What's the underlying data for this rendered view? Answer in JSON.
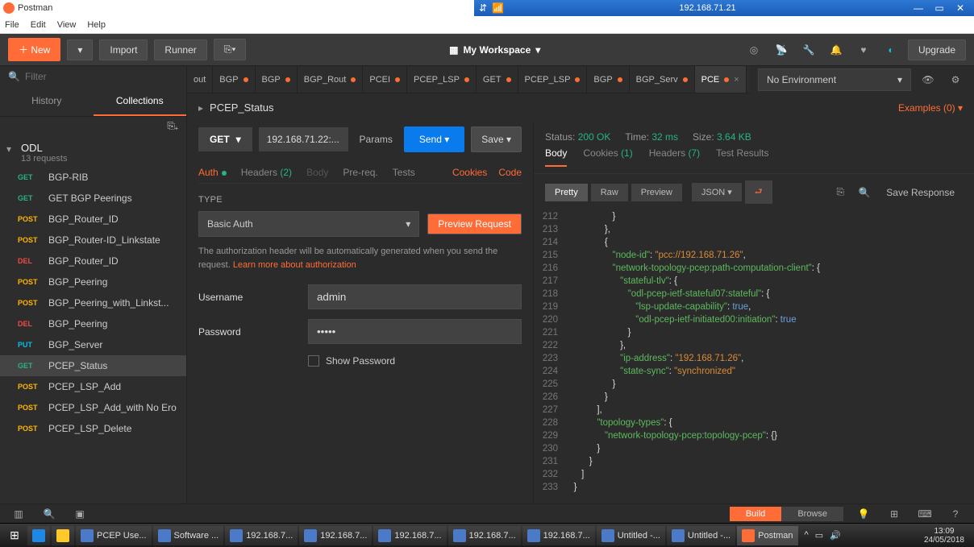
{
  "titlebar": {
    "app": "Postman",
    "ip": "192.168.71.21"
  },
  "menubar": [
    "File",
    "Edit",
    "View",
    "Help"
  ],
  "toolbar": {
    "new": "New",
    "import": "Import",
    "runner": "Runner",
    "workspace": "My Workspace",
    "upgrade": "Upgrade"
  },
  "sidebar": {
    "filter_placeholder": "Filter",
    "tabs": {
      "history": "History",
      "collections": "Collections"
    },
    "collection": {
      "name": "ODL",
      "sub": "13 requests"
    },
    "requests": [
      {
        "method": "GET",
        "name": "BGP-RIB"
      },
      {
        "method": "GET",
        "name": "GET BGP Peerings"
      },
      {
        "method": "POST",
        "name": "BGP_Router_ID"
      },
      {
        "method": "POST",
        "name": "BGP_Router-ID_Linkstate"
      },
      {
        "method": "DEL",
        "name": "BGP_Router_ID"
      },
      {
        "method": "POST",
        "name": "BGP_Peering"
      },
      {
        "method": "POST",
        "name": "BGP_Peering_with_Linkst..."
      },
      {
        "method": "DEL",
        "name": "BGP_Peering"
      },
      {
        "method": "PUT",
        "name": "BGP_Server"
      },
      {
        "method": "GET",
        "name": "PCEP_Status",
        "active": true
      },
      {
        "method": "POST",
        "name": "PCEP_LSP_Add"
      },
      {
        "method": "POST",
        "name": "PCEP_LSP_Add_with No Ero"
      },
      {
        "method": "POST",
        "name": "PCEP_LSP_Delete"
      }
    ]
  },
  "tabs": [
    {
      "label": "out",
      "dirty": false
    },
    {
      "label": "BGP",
      "dirty": true
    },
    {
      "label": "BGP",
      "dirty": true
    },
    {
      "label": "BGP_Rout",
      "dirty": true
    },
    {
      "label": "PCEI",
      "dirty": true
    },
    {
      "label": "PCEP_LSP",
      "dirty": true
    },
    {
      "label": "GET",
      "dirty": true
    },
    {
      "label": "PCEP_LSP",
      "dirty": true
    },
    {
      "label": "BGP",
      "dirty": true
    },
    {
      "label": "BGP_Serv",
      "dirty": true
    },
    {
      "label": "PCE",
      "active": true,
      "dirty": true
    }
  ],
  "env": {
    "selected": "No Environment"
  },
  "request": {
    "name": "PCEP_Status",
    "examples": "Examples (0)",
    "method": "GET",
    "url": "192.168.71.22:...",
    "params": "Params",
    "send": "Send",
    "save": "Save",
    "tabs": {
      "auth": "Auth",
      "headers": "Headers",
      "headers_cnt": "(2)",
      "body": "Body",
      "prereq": "Pre-req.",
      "tests": "Tests",
      "cookies": "Cookies",
      "code": "Code"
    },
    "type_label": "TYPE",
    "auth_type": "Basic Auth",
    "preview": "Preview Request",
    "help": "The authorization header will be automatically generated when you send the request. ",
    "help_link": "Learn more about authorization",
    "username_label": "Username",
    "username": "admin",
    "password_label": "Password",
    "password": "•••••",
    "show_pw": "Show Password"
  },
  "response": {
    "status_lbl": "Status:",
    "status": "200 OK",
    "time_lbl": "Time:",
    "time": "32 ms",
    "size_lbl": "Size:",
    "size": "3.64 KB",
    "tabs": {
      "body": "Body",
      "cookies": "Cookies",
      "cookies_cnt": "(1)",
      "headers": "Headers",
      "headers_cnt": "(7)",
      "tests": "Test Results"
    },
    "view": {
      "pretty": "Pretty",
      "raw": "Raw",
      "preview": "Preview",
      "fmt": "JSON"
    },
    "save": "Save Response",
    "lines": [
      {
        "n": 212,
        "t": "                  }"
      },
      {
        "n": 213,
        "t": "               },"
      },
      {
        "n": 214,
        "t": "               {"
      },
      {
        "n": 215,
        "t": "                  \"node-id\": \"pcc://192.168.71.26\","
      },
      {
        "n": 216,
        "t": "                  \"network-topology-pcep:path-computation-client\": {"
      },
      {
        "n": 217,
        "t": "                     \"stateful-tlv\": {"
      },
      {
        "n": 218,
        "t": "                        \"odl-pcep-ietf-stateful07:stateful\": {"
      },
      {
        "n": 219,
        "t": "                           \"lsp-update-capability\": true,"
      },
      {
        "n": 220,
        "t": "                           \"odl-pcep-ietf-initiated00:initiation\": true"
      },
      {
        "n": 221,
        "t": "                        }"
      },
      {
        "n": 222,
        "t": "                     },"
      },
      {
        "n": 223,
        "t": "                     \"ip-address\": \"192.168.71.26\","
      },
      {
        "n": 224,
        "t": "                     \"state-sync\": \"synchronized\""
      },
      {
        "n": 225,
        "t": "                  }"
      },
      {
        "n": 226,
        "t": "               }"
      },
      {
        "n": 227,
        "t": "            ],"
      },
      {
        "n": 228,
        "t": "            \"topology-types\": {"
      },
      {
        "n": 229,
        "t": "               \"network-topology-pcep:topology-pcep\": {}"
      },
      {
        "n": 230,
        "t": "            }"
      },
      {
        "n": 231,
        "t": "         }"
      },
      {
        "n": 232,
        "t": "      ]"
      },
      {
        "n": 233,
        "t": "   }"
      }
    ]
  },
  "statusbar": {
    "build": "Build",
    "browse": "Browse"
  },
  "taskbar": {
    "items": [
      {
        "label": "PCEP Use..."
      },
      {
        "label": "Software ..."
      },
      {
        "label": "192.168.7..."
      },
      {
        "label": "192.168.7..."
      },
      {
        "label": "192.168.7..."
      },
      {
        "label": "192.168.7..."
      },
      {
        "label": "192.168.7..."
      },
      {
        "label": "Untitled -..."
      },
      {
        "label": "Untitled -..."
      },
      {
        "label": "Postman",
        "active": true
      }
    ],
    "time": "13:09",
    "date": "24/05/2018"
  }
}
